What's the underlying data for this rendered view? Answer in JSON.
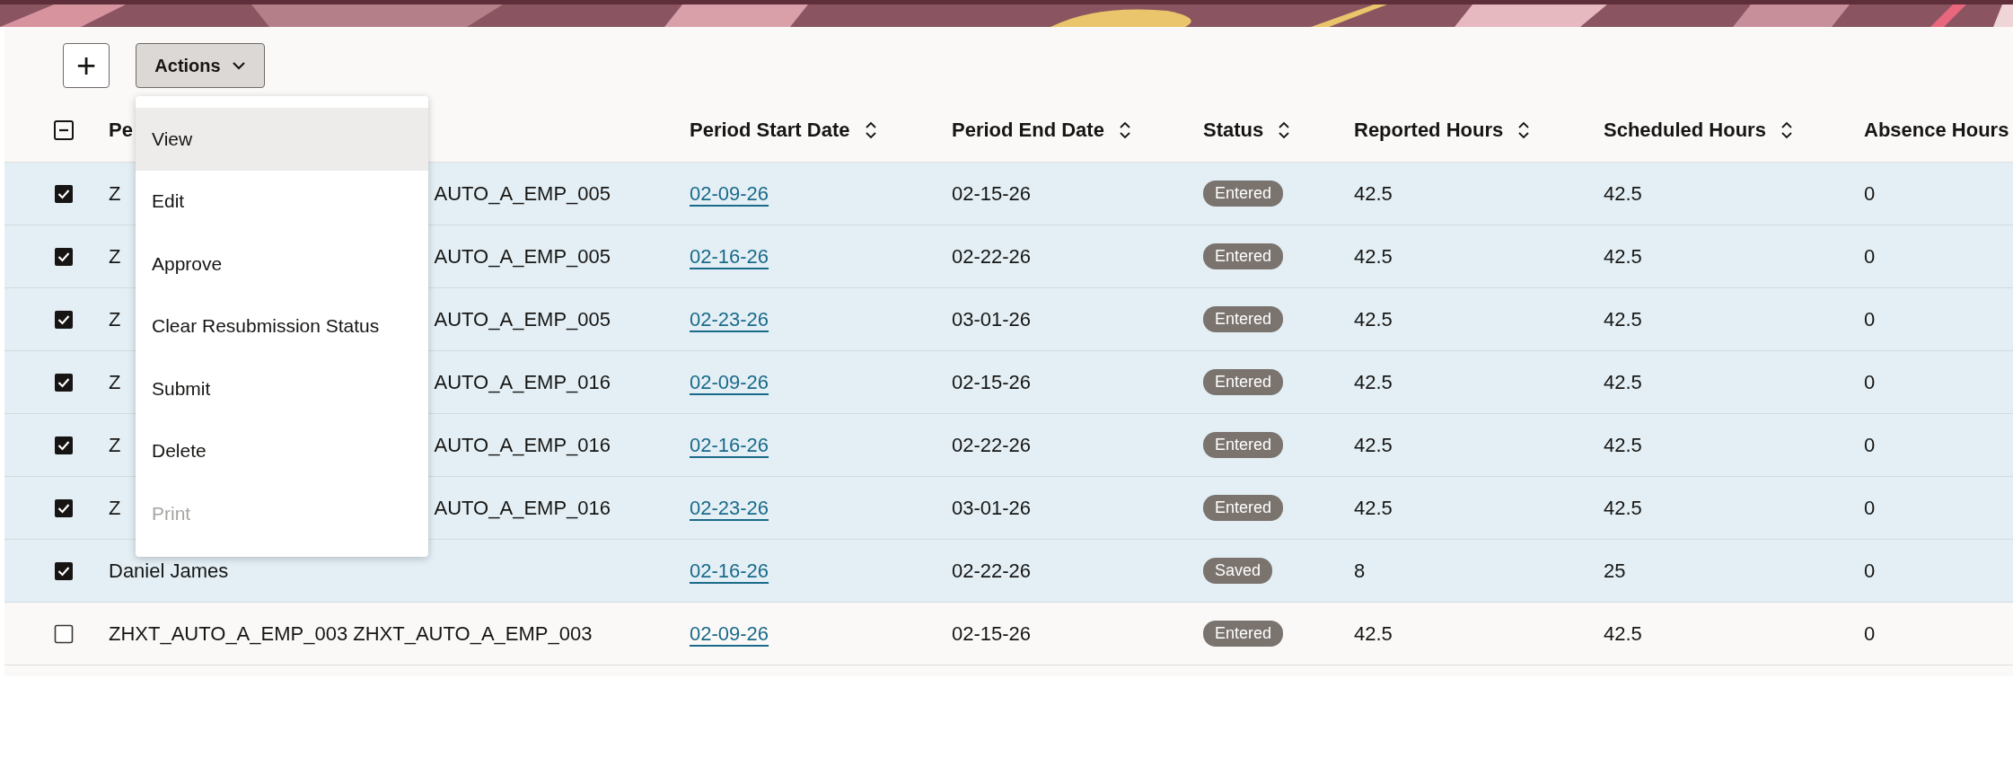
{
  "toolbar": {
    "add_button": "+",
    "actions_button": "Actions"
  },
  "table": {
    "select_all": {
      "indeterminate": true
    },
    "columns": [
      {
        "label": "Pe",
        "sortable": false
      },
      {
        "label": "Period Start Date",
        "sortable": true
      },
      {
        "label": "Period End Date",
        "sortable": true
      },
      {
        "label": "Status",
        "sortable": true
      },
      {
        "label": "Reported Hours",
        "sortable": true
      },
      {
        "label": "Scheduled Hours",
        "sortable": true
      },
      {
        "label": "Absence Hours",
        "sortable": false
      }
    ],
    "rows": [
      {
        "selected": true,
        "person_start": "Z",
        "person_end": "AUTO_A_EMP_005",
        "start": "02-09-26",
        "end": "02-15-26",
        "status": "Entered",
        "reported": "42.5",
        "scheduled": "42.5",
        "absence": "0"
      },
      {
        "selected": true,
        "person_start": "Z",
        "person_end": "AUTO_A_EMP_005",
        "start": "02-16-26",
        "end": "02-22-26",
        "status": "Entered",
        "reported": "42.5",
        "scheduled": "42.5",
        "absence": "0"
      },
      {
        "selected": true,
        "person_start": "Z",
        "person_end": "AUTO_A_EMP_005",
        "start": "02-23-26",
        "end": "03-01-26",
        "status": "Entered",
        "reported": "42.5",
        "scheduled": "42.5",
        "absence": "0"
      },
      {
        "selected": true,
        "person_start": "Z",
        "person_end": "AUTO_A_EMP_016",
        "start": "02-09-26",
        "end": "02-15-26",
        "status": "Entered",
        "reported": "42.5",
        "scheduled": "42.5",
        "absence": "0"
      },
      {
        "selected": true,
        "person_start": "Z",
        "person_end": "AUTO_A_EMP_016",
        "start": "02-16-26",
        "end": "02-22-26",
        "status": "Entered",
        "reported": "42.5",
        "scheduled": "42.5",
        "absence": "0"
      },
      {
        "selected": true,
        "person_start": "Z",
        "person_end": "AUTO_A_EMP_016",
        "start": "02-23-26",
        "end": "03-01-26",
        "status": "Entered",
        "reported": "42.5",
        "scheduled": "42.5",
        "absence": "0"
      },
      {
        "selected": true,
        "person": "Daniel James",
        "start": "02-16-26",
        "end": "02-22-26",
        "status": "Saved",
        "reported": "8",
        "scheduled": "25",
        "absence": "0"
      },
      {
        "selected": false,
        "person": "ZHXT_AUTO_A_EMP_003 ZHXT_AUTO_A_EMP_003",
        "start": "02-09-26",
        "end": "02-15-26",
        "status": "Entered",
        "reported": "42.5",
        "scheduled": "42.5",
        "absence": "0"
      }
    ]
  },
  "actions_menu": {
    "items": [
      {
        "label": "View",
        "highlighted": true,
        "disabled": false
      },
      {
        "label": "Edit",
        "highlighted": false,
        "disabled": false
      },
      {
        "label": "Approve",
        "highlighted": false,
        "disabled": false
      },
      {
        "label": "Clear Resubmission Status",
        "highlighted": false,
        "disabled": false
      },
      {
        "label": "Submit",
        "highlighted": false,
        "disabled": false
      },
      {
        "label": "Delete",
        "highlighted": false,
        "disabled": false
      },
      {
        "label": "Print",
        "highlighted": false,
        "disabled": true
      }
    ]
  }
}
